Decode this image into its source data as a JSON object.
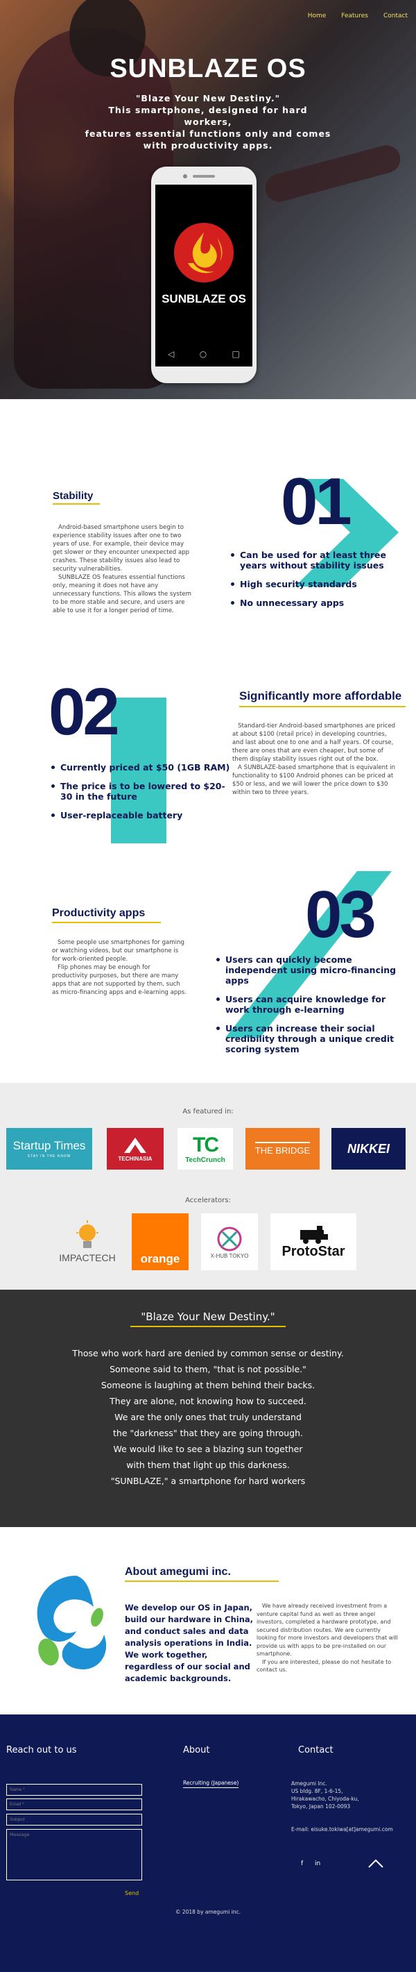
{
  "nav": {
    "items": [
      "Home",
      "Features",
      "Contact"
    ]
  },
  "hero": {
    "title": "SUNBLAZE OS",
    "tagline": "\"Blaze Your New Destiny.\"",
    "lines": [
      "This smartphone, designed for hard workers,",
      "features essential functions only and comes",
      "with productivity apps."
    ],
    "phone_logo_text": "SUNBLAZE OS",
    "phone_buttons": [
      "◁",
      "○",
      "□"
    ]
  },
  "stability": {
    "number": "01",
    "title": "Stability",
    "para1": "Android-based smartphone users begin to experience stability issues after one to two years of use. For example, their device may get slower or they encounter unexpected app crashes. These stability issues also lead to security vulnerabilities.",
    "para2": "SUNBLAZE OS features essential functions only, meaning it does not have any unnecessary functions. This allows the system to be more stable and secure, and users are able to use it for a longer period of time.",
    "bullets": [
      "Can be used for at least three years without stability issues",
      "High security standards",
      "No unnecessary apps"
    ]
  },
  "affordable": {
    "number": "02",
    "title": "Significantly more affordable",
    "para1": "Standard-tier Android-based smartphones are priced at about $100 (retail price) in developing countries, and last about one to one and a half years. Of course, there are ones that are even cheaper, but some of them display stability issues right out of the box.",
    "para2": "A SUNBLAZE-based smartphone that is equivalent in functionality to $100 Android phones can be priced at $50 or less, and we will lower the price down to $30 within two to three years.",
    "bullets": [
      "Currently priced at $50 (1GB RAM)",
      "The price is to be lowered to $20-30 in the future",
      "User-replaceable battery"
    ]
  },
  "productivity": {
    "number": "03",
    "title": "Productivity apps",
    "para1": "Some people use smartphones for gaming or watching videos, but our smartphone is for work-oriented people.",
    "para2": "Flip phones may be enough for productivity purposes, but there are many apps that are not supported by them, such as micro-financing apps and e-learning apps.",
    "bullets": [
      "Users can quickly become independent using micro-financing apps",
      "Users can acquire knowledge for work through e-learning",
      "Users can increase their social credibility through a unique credit scoring system"
    ]
  },
  "featured": {
    "label": "As featured in:",
    "logos": [
      {
        "name": "Startup Times",
        "sub": "STAY IN THE KNOW"
      },
      {
        "name": "TECHINASIA",
        "sub": ""
      },
      {
        "name": "TechCrunch",
        "sub": ""
      },
      {
        "name": "THE BRIDGE",
        "sub": ""
      },
      {
        "name": "NIKKEI",
        "sub": ""
      }
    ],
    "accel_label": "Accelerators:",
    "accelerators": [
      {
        "name": "IMPACTECH"
      },
      {
        "name": "orange"
      },
      {
        "name": "X-HUB TOKYO"
      },
      {
        "name": "ProtoStar"
      }
    ]
  },
  "quote": {
    "title": "\"Blaze Your New Destiny.\"",
    "lines": [
      "Those who work hard are denied by common sense or destiny.",
      "Someone said to them, \"that is not possible.\"",
      "Someone is laughing at them behind their backs.",
      "They are alone, not knowing how to succeed.",
      "We are the only ones that truly understand",
      "the \"darkness\" that they are going through.",
      "We would like to see a blazing sun together",
      "with them that light up this darkness.",
      "\"SUNBLAZE,\" a smartphone for hard workers"
    ]
  },
  "about": {
    "title": "About amegumi inc.",
    "big": "We develop our OS in Japan, build our hardware in China, and conduct sales and data analysis operations in India. We work together, regardless of our social and academic backgrounds.",
    "para1": "We have already received investment from a venture capital fund as well as three angel investors, completed a hardware prototype, and secured distribution routes. We are currently looking for more investors and developers that will provide us with apps to be pre-installed on our smartphone.",
    "para2": "If you are interested, please do not hesitate to contact us."
  },
  "footer": {
    "reach_title": "Reach out to us",
    "fields": {
      "name": "Name *",
      "email": "Email *",
      "subject": "Subject",
      "message": "Message"
    },
    "send": "Send",
    "about_title": "About",
    "about_link": "Recruiting (Japanese)",
    "contact_title": "Contact",
    "address": [
      "Amegumi Inc.",
      "US bldg. 8F, 1-6-15,",
      "Hirakawacho, Chiyoda-ku,",
      "Tokyo, Japan 102-0093"
    ],
    "email": "E-mail: eisuke.tokiwa[at]amegumi.com",
    "social": [
      "f",
      "in"
    ],
    "copyright": "© 2018 by amegumi inc."
  }
}
